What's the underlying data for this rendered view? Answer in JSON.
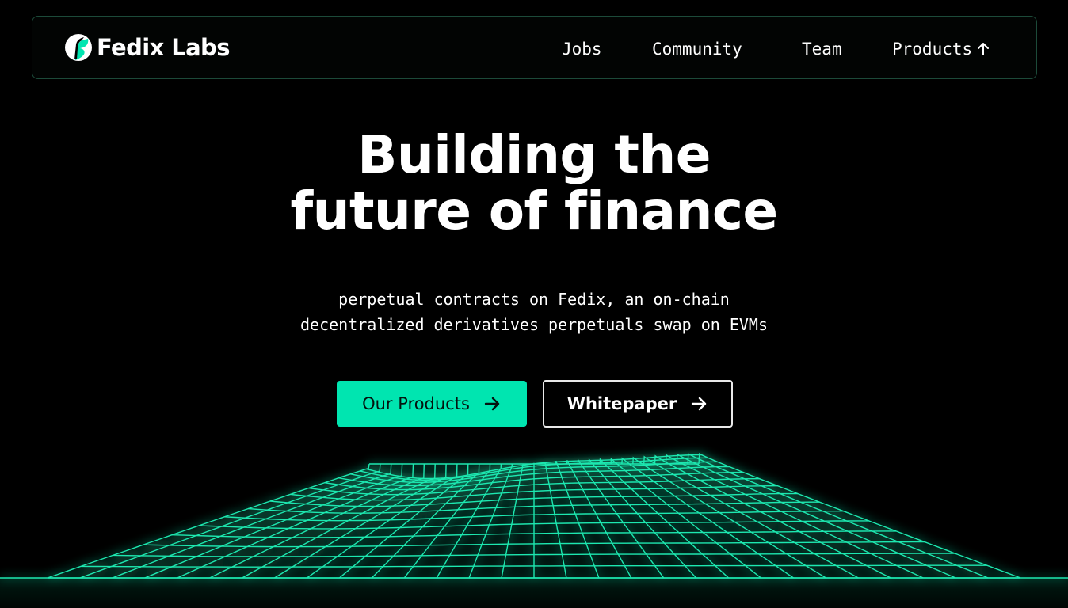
{
  "brand": {
    "name": "Fedix Labs",
    "accent": "#00e5b0"
  },
  "nav": {
    "items": [
      {
        "label": "Jobs"
      },
      {
        "label": "Community"
      },
      {
        "label": "Team"
      },
      {
        "label": "Products",
        "icon": "arrow-up-icon"
      }
    ]
  },
  "hero": {
    "title_line1": "Building the",
    "title_line2": "future of finance",
    "subtitle_line1": "perpetual contracts on Fedix, an on-chain",
    "subtitle_line2": "decentralized derivatives perpetuals swap on EVMs"
  },
  "buttons": {
    "primary": {
      "label": "Our Products",
      "icon": "arrow-right-icon",
      "color": "#00e5b0"
    },
    "secondary": {
      "label": "Whitepaper",
      "icon": "arrow-right-icon"
    }
  },
  "decor": {
    "grid_color": "#1ee8b0",
    "background": "#000000"
  }
}
